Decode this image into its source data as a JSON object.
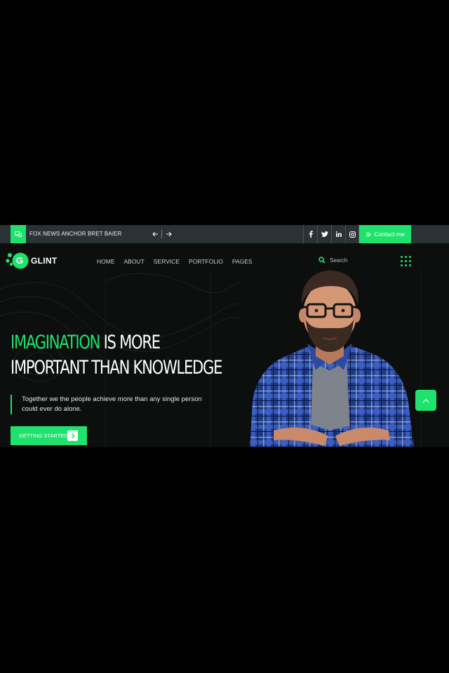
{
  "topbar": {
    "news_text": "FOX NEWS ANCHOR BRET BAIER",
    "chat_icon": "chat-icon",
    "contact_label": "Contact me",
    "social": [
      "facebook-icon",
      "twitter-icon",
      "linkedin-icon",
      "instagram-icon"
    ]
  },
  "brand": {
    "logo_letter": "G",
    "logo_text": "GLINT"
  },
  "nav": {
    "items": [
      "HOME",
      "ABOUT",
      "SERVICE",
      "PORTFOLIO",
      "PAGES"
    ],
    "search_placeholder": "Search"
  },
  "hero": {
    "headline_highlight": "IMAGINATION",
    "headline_rest_1": " IS MORE",
    "headline_line_2": "IMPORTANT THAN KNOWLEDGE",
    "description": "Together we the people achieve more than any single person could ever do alone.",
    "cta_label": "GETTING STARTED"
  },
  "colors": {
    "accent": "#1fe26e",
    "background": "#0c0f0e",
    "topbar": "#2a3236",
    "page": "#000000"
  }
}
